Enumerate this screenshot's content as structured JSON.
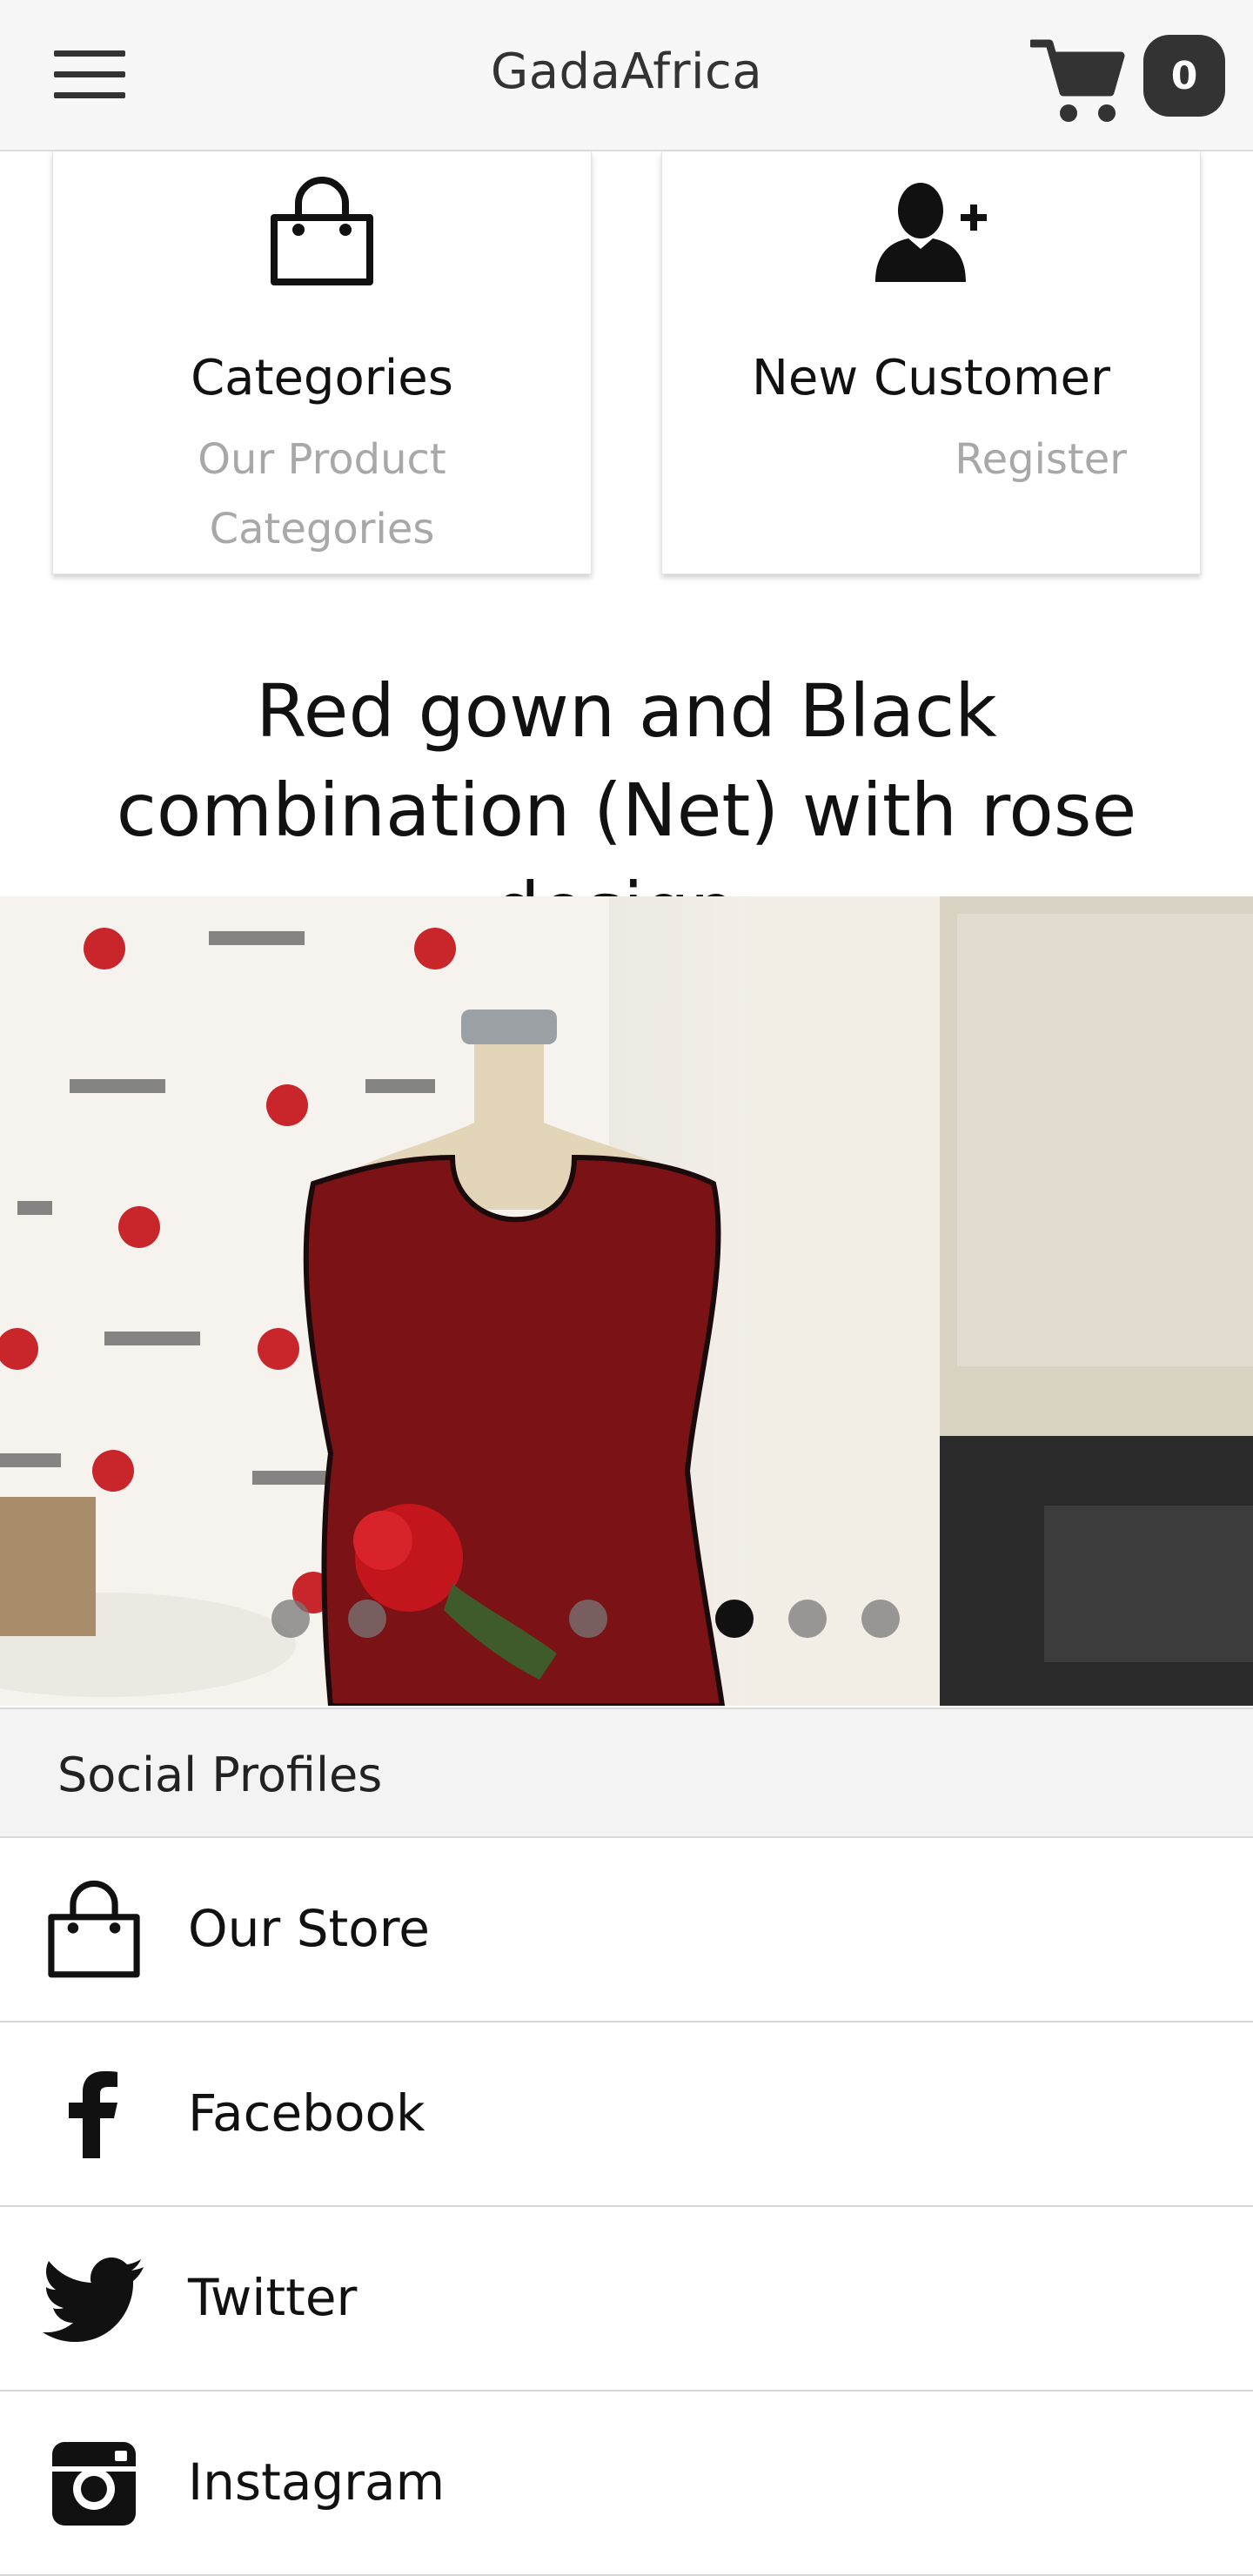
{
  "header": {
    "title": "GadaAfrica",
    "cart_count": "0"
  },
  "cards": [
    {
      "title": "Categories",
      "subtitle": "Our Product Categories",
      "icon": "shopping-bag-icon"
    },
    {
      "title": "New Customer",
      "subtitle": "Register",
      "icon": "add-user-icon"
    }
  ],
  "product": {
    "title": "Red gown and Black combination (Net) with rose design.",
    "carousel_active_index": 3,
    "carousel_slide_count": 6
  },
  "social": {
    "header": "Social Profiles",
    "items": [
      {
        "label": "Our Store",
        "icon": "shopping-bag-icon"
      },
      {
        "label": "Facebook",
        "icon": "facebook-icon"
      },
      {
        "label": "Twitter",
        "icon": "twitter-icon"
      },
      {
        "label": "Instagram",
        "icon": "instagram-icon"
      }
    ]
  },
  "colors": {
    "header_bg": "#f7f7f7",
    "badge_bg": "#333333",
    "muted_text": "#a8a8a8",
    "gown_red": "#b3141b"
  }
}
